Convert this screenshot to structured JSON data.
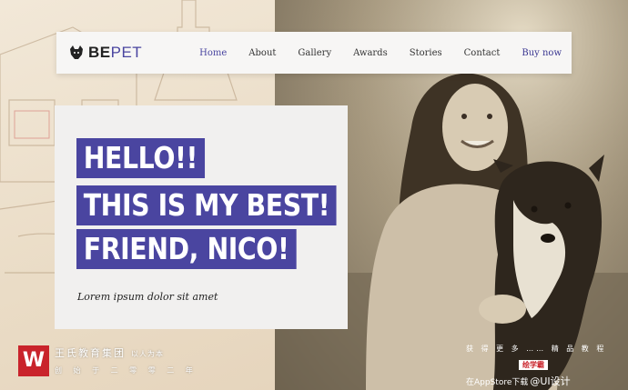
{
  "brand": {
    "part1": "BE",
    "part2": "PET",
    "icon": "dog-head-icon"
  },
  "nav": {
    "items": [
      {
        "label": "Home",
        "active": true
      },
      {
        "label": "About"
      },
      {
        "label": "Gallery"
      },
      {
        "label": "Awards"
      },
      {
        "label": "Stories"
      },
      {
        "label": "Contact"
      }
    ],
    "cta": "Buy now"
  },
  "hero": {
    "line1": "HELLO!!",
    "line2": "THIS IS MY BEST!",
    "line3": "FRIEND, NICO!",
    "subtitle": "Lorem ipsum dolor sit amet"
  },
  "watermark_left": {
    "logo_letter": "W",
    "title": "王氏教育集团",
    "tagline": "以人为本",
    "founded": "创 始 于 二 零 零 二 年"
  },
  "watermark_right": {
    "line1": "获 得 更 多 …… 精 品 教 程",
    "badge": "绘学霸",
    "line3": "在AppStore下载",
    "weibo": "@UI设计"
  },
  "colors": {
    "accent": "#4a45a0",
    "card_bg": "#f1f0ef",
    "navbar_bg": "#f7f6f5",
    "watermark_red": "#c9232b"
  }
}
